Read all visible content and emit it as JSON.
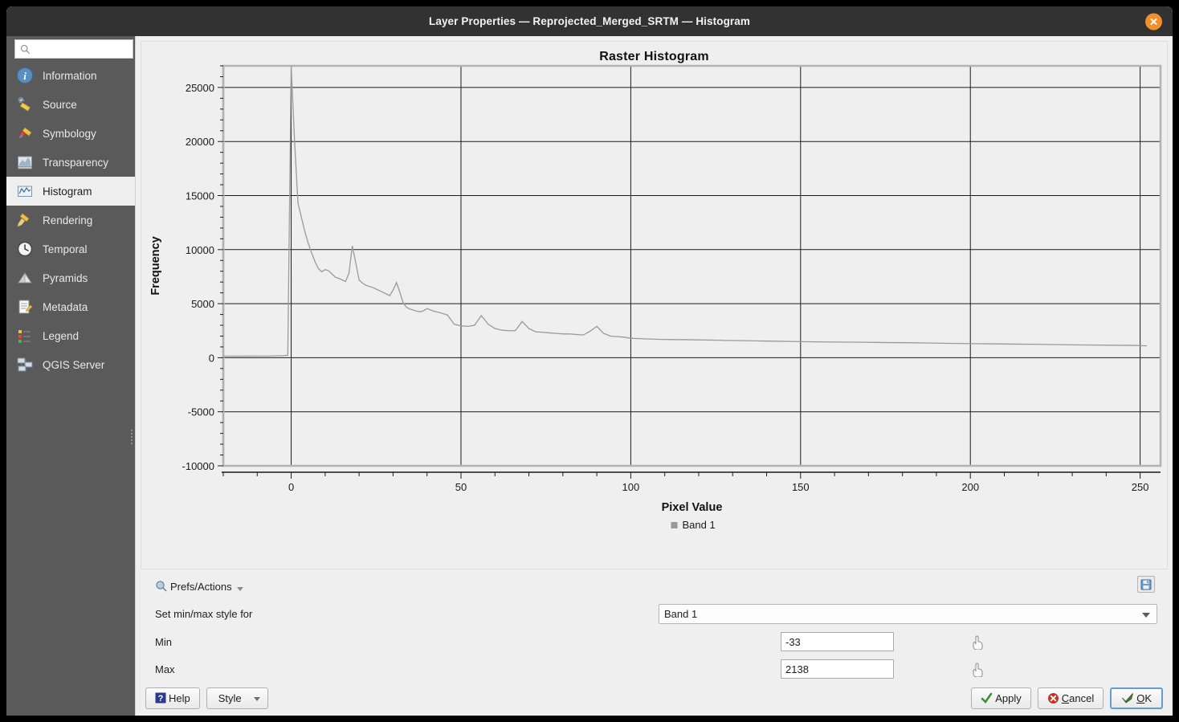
{
  "window": {
    "title": "Layer Properties — Reprojected_Merged_SRTM — Histogram",
    "close_label": "✕"
  },
  "sidebar": {
    "search_placeholder": "",
    "search_value": "",
    "items": [
      {
        "label": "Information",
        "icon": "info-icon",
        "active": false
      },
      {
        "label": "Source",
        "icon": "source-icon",
        "active": false
      },
      {
        "label": "Symbology",
        "icon": "symbology-icon",
        "active": false
      },
      {
        "label": "Transparency",
        "icon": "transparency-icon",
        "active": false
      },
      {
        "label": "Histogram",
        "icon": "histogram-icon",
        "active": true
      },
      {
        "label": "Rendering",
        "icon": "rendering-icon",
        "active": false
      },
      {
        "label": "Temporal",
        "icon": "temporal-icon",
        "active": false
      },
      {
        "label": "Pyramids",
        "icon": "pyramids-icon",
        "active": false
      },
      {
        "label": "Metadata",
        "icon": "metadata-icon",
        "active": false
      },
      {
        "label": "Legend",
        "icon": "legend-icon",
        "active": false
      },
      {
        "label": "QGIS Server",
        "icon": "qgis-server-icon",
        "active": false
      }
    ]
  },
  "controls": {
    "prefs_label": "Prefs/Actions",
    "save_tooltip": "save-icon",
    "band_row_label": "Set min/max style for",
    "band_value": "Band 1",
    "min_label": "Min",
    "min_value": "-33",
    "max_label": "Max",
    "max_value": "2138"
  },
  "footer": {
    "help": "Help",
    "style": "Style",
    "apply": "Apply",
    "cancel": "Cancel",
    "ok": "OK"
  },
  "chart_data": {
    "type": "line",
    "title": "Raster Histogram",
    "xlabel": "Pixel Value",
    "ylabel": "Frequency",
    "legend": [
      "Band 1"
    ],
    "legend_position": "bottom",
    "grid": true,
    "xlim": [
      -20,
      256
    ],
    "ylim": [
      -10000,
      27000
    ],
    "xticks": [
      0,
      50,
      100,
      150,
      200,
      250
    ],
    "yticks": [
      -10000,
      -5000,
      0,
      5000,
      10000,
      15000,
      20000,
      25000
    ],
    "series": [
      {
        "name": "Band 1",
        "color": "#9a9a9a",
        "x": [
          -20,
          -10,
          -6,
          -4,
          -2,
          -1,
          0,
          1,
          2,
          3,
          4,
          5,
          6,
          7,
          8,
          9,
          10,
          11,
          12,
          13,
          14,
          15,
          16,
          17,
          18,
          19,
          20,
          21,
          22,
          23,
          24,
          25,
          26,
          27,
          28,
          29,
          30,
          31,
          32,
          33,
          34,
          35,
          36,
          37,
          38,
          39,
          40,
          42,
          44,
          46,
          48,
          50,
          52,
          54,
          56,
          58,
          60,
          62,
          64,
          66,
          68,
          70,
          72,
          74,
          76,
          78,
          80,
          82,
          84,
          86,
          88,
          90,
          92,
          94,
          96,
          98,
          100,
          104,
          108,
          112,
          116,
          120,
          124,
          128,
          132,
          136,
          140,
          144,
          148,
          152,
          156,
          160,
          164,
          168,
          172,
          176,
          180,
          184,
          188,
          192,
          196,
          200,
          204,
          208,
          212,
          216,
          220,
          224,
          228,
          232,
          236,
          240,
          244,
          248,
          252,
          255
        ],
        "y": [
          140,
          150,
          160,
          180,
          200,
          220,
          27000,
          20000,
          14300,
          13000,
          11700,
          10600,
          9700,
          8900,
          8250,
          7950,
          8150,
          8050,
          7750,
          7450,
          7350,
          7200,
          7050,
          7800,
          10350,
          8800,
          7200,
          6900,
          6700,
          6600,
          6500,
          6350,
          6200,
          6050,
          5900,
          5750,
          6250,
          6950,
          6050,
          5050,
          4650,
          4500,
          4400,
          4300,
          4250,
          4350,
          4550,
          4300,
          4150,
          3950,
          3100,
          2950,
          2900,
          3000,
          3900,
          3100,
          2700,
          2550,
          2500,
          2500,
          3350,
          2700,
          2400,
          2350,
          2300,
          2250,
          2200,
          2200,
          2150,
          2100,
          2450,
          2900,
          2250,
          2000,
          1950,
          1900,
          1800,
          1750,
          1700,
          1680,
          1670,
          1650,
          1630,
          1600,
          1580,
          1560,
          1540,
          1520,
          1500,
          1480,
          1460,
          1450,
          1440,
          1430,
          1420,
          1400,
          1390,
          1380,
          1360,
          1340,
          1320,
          1300,
          1290,
          1280,
          1260,
          1250,
          1240,
          1220,
          1200,
          1180,
          1170,
          1160,
          1150,
          1140,
          1100
        ]
      }
    ]
  }
}
